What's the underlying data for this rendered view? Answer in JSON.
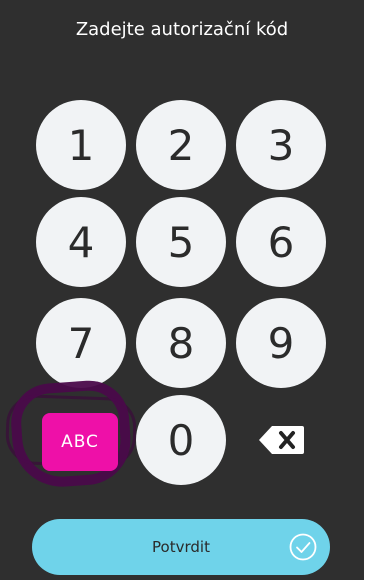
{
  "header": {
    "title": "Zadejte autorizační kód"
  },
  "keypad": {
    "digits": [
      "1",
      "2",
      "3",
      "4",
      "5",
      "6",
      "7",
      "8",
      "9",
      "0"
    ],
    "abc_label": "ABC",
    "backspace_icon": "backspace-icon"
  },
  "actions": {
    "confirm_label": "Potvrdit",
    "confirm_icon": "check-circle-icon"
  },
  "colors": {
    "background": "#2f2f2f",
    "key": "#f1f3f5",
    "abc_key": "#ee10a8",
    "confirm_button": "#6fd3ea",
    "annotation_circle": "#4a0a4a"
  }
}
